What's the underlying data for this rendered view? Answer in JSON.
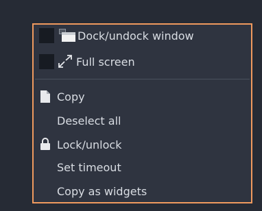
{
  "menu": {
    "items": [
      {
        "id": "dock",
        "label": "Dock/undock window",
        "icon": "dock-window-icon"
      },
      {
        "id": "fullscreen",
        "label": "Full screen",
        "icon": "fullscreen-icon"
      },
      {
        "id": "copy",
        "label": "Copy",
        "icon": "document-icon"
      },
      {
        "id": "deselect",
        "label": "Deselect all",
        "icon": ""
      },
      {
        "id": "lock",
        "label": "Lock/unlock",
        "icon": "lock-icon"
      },
      {
        "id": "timeout",
        "label": "Set timeout",
        "icon": ""
      },
      {
        "id": "copy_widgets",
        "label": "Copy as widgets",
        "icon": ""
      }
    ]
  },
  "colors": {
    "background": "#262b35",
    "menu_background": "#2f3440",
    "menu_border": "#f09a5e",
    "text": "#d9dde3",
    "separator": "#4b515d"
  }
}
